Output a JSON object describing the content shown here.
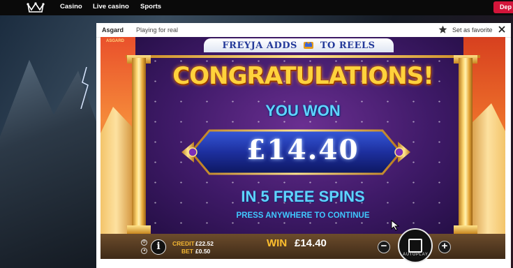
{
  "nav": {
    "links": [
      "Casino",
      "Live casino",
      "Sports"
    ],
    "deposit_label": "Dep"
  },
  "window": {
    "title": "Asgard",
    "mode": "Playing for real",
    "favorite_label": "Set as favorite"
  },
  "game": {
    "tag": "ASGARD",
    "banner_left": "FREYJA ADDS",
    "banner_right": "TO REELS",
    "congrats": "CONGRATULATIONS!",
    "you_won": "YOU WON",
    "amount": "£14.40",
    "free_spins": "IN 5 FREE SPINS",
    "continue": "PRESS ANYWHERE TO CONTINUE"
  },
  "bar": {
    "credit_label": "CREDIT",
    "credit_value": "£22.52",
    "bet_label": "BET",
    "bet_value": "£0.50",
    "win_label": "WIN",
    "win_value": "£14.40",
    "autoplay_label": "AUTOPLAY"
  },
  "colors": {
    "accent_red": "#d3153a",
    "gold": "#ffd23c",
    "cyan_text": "#5fd4ff"
  }
}
